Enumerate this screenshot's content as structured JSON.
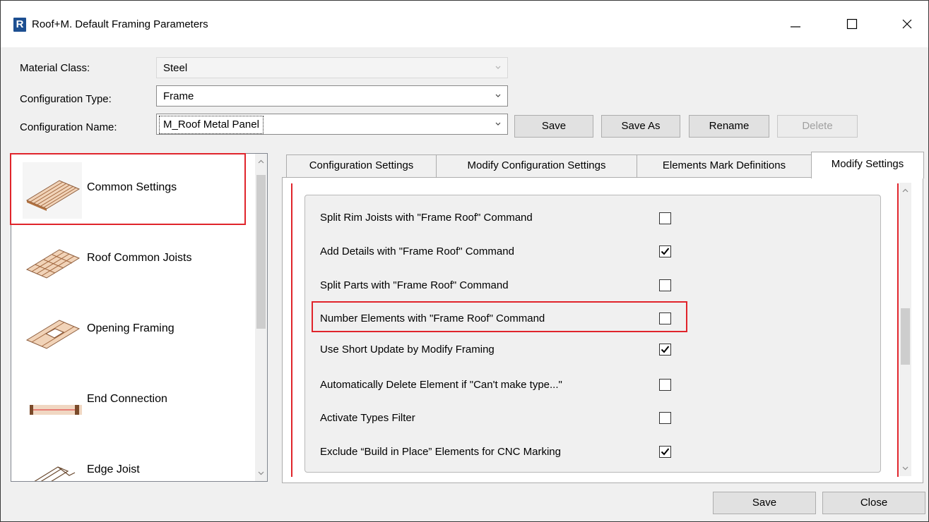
{
  "window": {
    "title": "Roof+M. Default Framing Parameters",
    "app_icon_letter": "R"
  },
  "header": {
    "material_class_label": "Material Class:",
    "material_class_value": "Steel",
    "configuration_type_label": "Configuration Type:",
    "configuration_type_value": "Frame",
    "configuration_name_label": "Configuration Name:",
    "configuration_name_value": "M_Roof Metal Panel",
    "buttons": {
      "save": "Save",
      "save_as": "Save As",
      "rename": "Rename",
      "delete": "Delete"
    }
  },
  "left_list": {
    "items": [
      {
        "label": "Common Settings",
        "icon": "common-settings-icon",
        "selected": true
      },
      {
        "label": "Roof Common Joists",
        "icon": "roof-common-joists-icon"
      },
      {
        "label": "Opening Framing",
        "icon": "opening-framing-icon"
      },
      {
        "label": "End Connection",
        "icon": "end-connection-icon"
      },
      {
        "label": "Edge Joist",
        "icon": "edge-joist-icon"
      }
    ]
  },
  "tabs": [
    {
      "label": "Configuration Settings"
    },
    {
      "label": "Modify Configuration Settings"
    },
    {
      "label": "Elements Mark Definitions"
    },
    {
      "label": "Modify Settings",
      "active": true
    }
  ],
  "settings": [
    {
      "label": "Split Rim Joists with \"Frame Roof\" Command",
      "checked": false
    },
    {
      "label": "Add Details with \"Frame Roof\" Command",
      "checked": true
    },
    {
      "label": "Split Parts with \"Frame Roof\" Command",
      "checked": false
    },
    {
      "label": "Number Elements with \"Frame Roof\" Command",
      "checked": false,
      "highlighted": true
    },
    {
      "label": "Use Short Update by Modify Framing",
      "checked": true
    },
    {
      "label": "Automatically Delete Element if \"Can't make type...\"",
      "checked": false
    },
    {
      "label": "Activate Types Filter",
      "checked": false
    },
    {
      "label": "Exclude “Build in Place” Elements for CNC Marking",
      "checked": true
    }
  ],
  "footer": {
    "save": "Save",
    "close": "Close"
  },
  "colors": {
    "highlight": "#e0242b",
    "wood": "#c8875a"
  }
}
